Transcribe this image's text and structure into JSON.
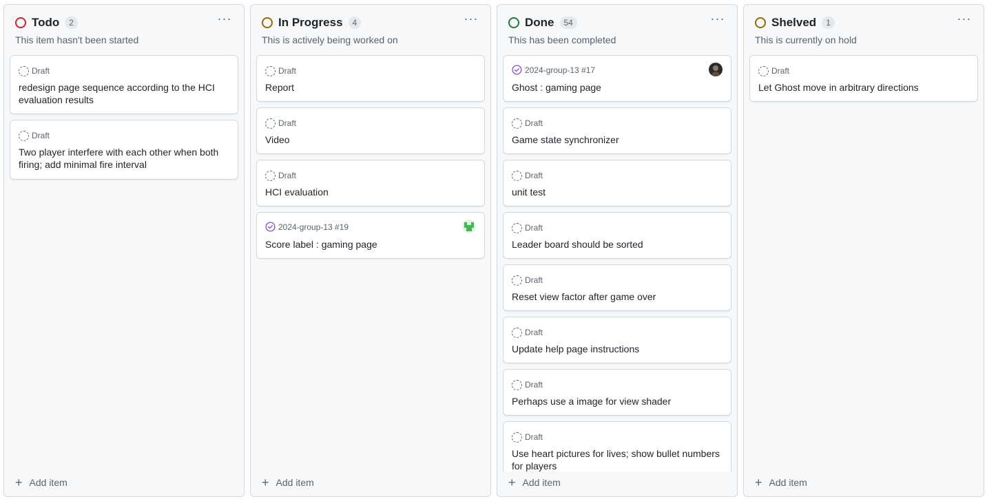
{
  "add_item_label": "Add item",
  "more_glyph": "···",
  "columns": [
    {
      "title": "Todo",
      "count": "2",
      "description": "This item hasn't been started",
      "status_color": "#cf222e",
      "cards": [
        {
          "meta": "Draft",
          "type": "draft",
          "title": "redesign page sequence according to the HCI evaluation results"
        },
        {
          "meta": "Draft",
          "type": "draft",
          "title": "Two player interfere with each other when both firing; add minimal fire interval"
        }
      ]
    },
    {
      "title": "In Progress",
      "count": "4",
      "description": "This is actively being worked on",
      "status_color": "#9a6700",
      "cards": [
        {
          "meta": "Draft",
          "type": "draft",
          "title": "Report"
        },
        {
          "meta": "Draft",
          "type": "draft",
          "title": "Video"
        },
        {
          "meta": "Draft",
          "type": "draft",
          "title": "HCI evaluation"
        },
        {
          "meta": "2024-group-13 #19",
          "type": "issue-closed",
          "title": "Score label : gaming page",
          "avatar": "green-identicon"
        }
      ]
    },
    {
      "title": "Done",
      "count": "54",
      "description": "This has been completed",
      "status_color": "#1a7f37",
      "cards": [
        {
          "meta": "2024-group-13 #17",
          "type": "issue-closed",
          "title": "Ghost : gaming page",
          "avatar": "photo"
        },
        {
          "meta": "Draft",
          "type": "draft",
          "title": "Game state synchronizer"
        },
        {
          "meta": "Draft",
          "type": "draft",
          "title": "unit test"
        },
        {
          "meta": "Draft",
          "type": "draft",
          "title": "Leader board should be sorted"
        },
        {
          "meta": "Draft",
          "type": "draft",
          "title": "Reset view factor after game over"
        },
        {
          "meta": "Draft",
          "type": "draft",
          "title": "Update help page instructions"
        },
        {
          "meta": "Draft",
          "type": "draft",
          "title": "Perhaps use a image for view shader"
        },
        {
          "meta": "Draft",
          "type": "draft",
          "title": "Use heart pictures for lives; show bullet numbers for players"
        }
      ]
    },
    {
      "title": "Shelved",
      "count": "1",
      "description": "This is currently on hold",
      "status_color": "#9a6700",
      "cards": [
        {
          "meta": "Draft",
          "type": "draft",
          "title": "Let Ghost move in arbitrary directions"
        }
      ]
    }
  ]
}
